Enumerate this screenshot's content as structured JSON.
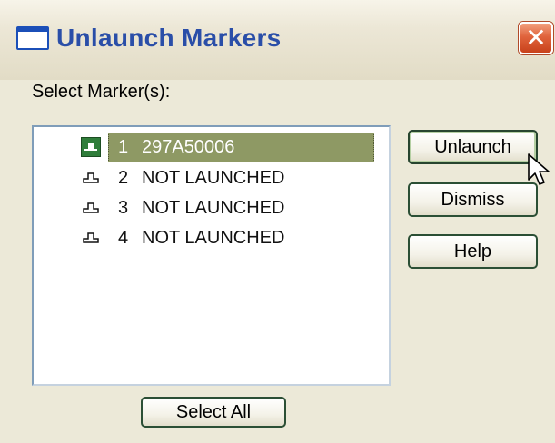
{
  "window": {
    "title": "Unlaunch Markers",
    "close_glyph": "✕"
  },
  "prompt": "Select Marker(s):",
  "markers": [
    {
      "index": "1",
      "label": "297A50006",
      "selected": true,
      "icon": "launched-marker-icon"
    },
    {
      "index": "2",
      "label": "NOT LAUNCHED",
      "selected": false,
      "icon": "marker-outline-icon"
    },
    {
      "index": "3",
      "label": "NOT LAUNCHED",
      "selected": false,
      "icon": "marker-outline-icon"
    },
    {
      "index": "4",
      "label": "NOT LAUNCHED",
      "selected": false,
      "icon": "marker-outline-icon"
    }
  ],
  "buttons": {
    "unlaunch": "Unlaunch",
    "dismiss": "Dismiss",
    "help": "Help",
    "select_all": "Select All"
  },
  "colors": {
    "selection": "#8e9964",
    "title_text": "#2a4ea8",
    "dialog_background": "#ece9d8",
    "close_button": "#e0633c"
  }
}
